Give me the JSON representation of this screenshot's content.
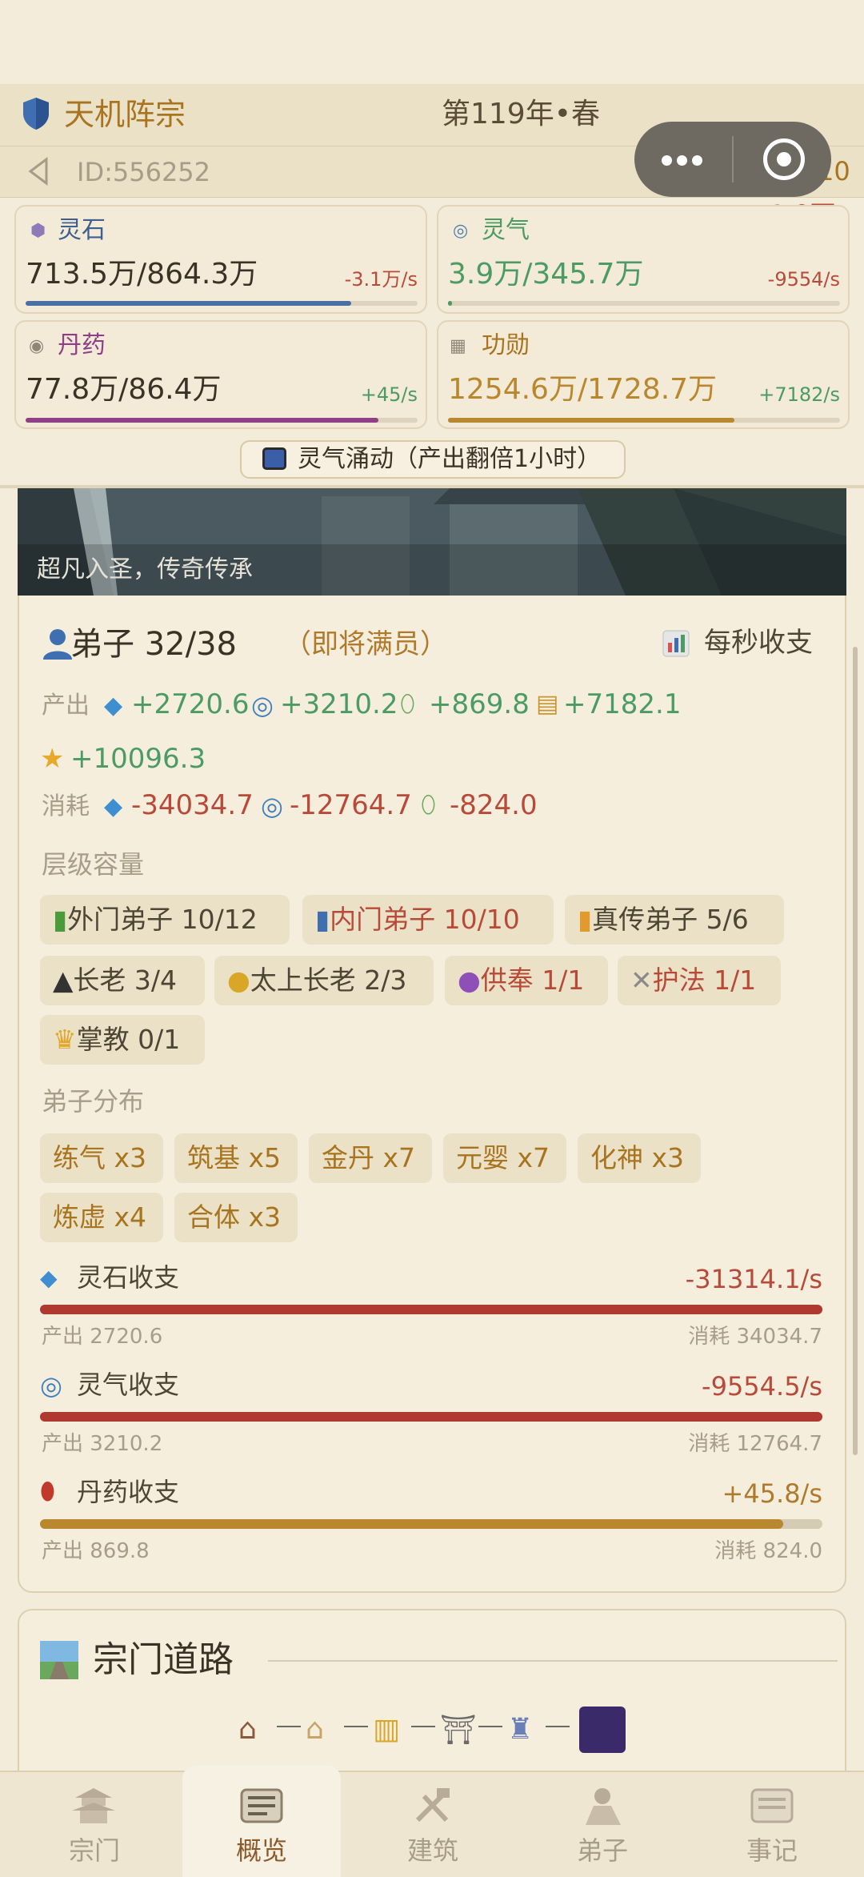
{
  "header": {
    "sect_name": "天机阵宗",
    "year": "第119年•春",
    "user_id": "ID:556252",
    "fame": "10",
    "fame_change": "-1.0万"
  },
  "resources": [
    {
      "name": "灵石",
      "value": "713.5万/864.3万",
      "rate": "-3.1万/s",
      "fill": 0.83,
      "color": "#4a6fa5",
      "icon": "spirit-stone-icon"
    },
    {
      "name": "灵气",
      "value": "3.9万/345.7万",
      "rate": "-9554/s",
      "fill": 0.01,
      "color": "#4b9b62",
      "icon": "qi-swirl-icon"
    },
    {
      "name": "丹药",
      "value": "77.8万/86.4万",
      "rate": "+45/s",
      "fill": 0.9,
      "color": "#8e3f86",
      "icon": "pill-icon"
    },
    {
      "name": "功勋",
      "value": "1254.6万/1728.7万",
      "rate": "+7182/s",
      "fill": 0.73,
      "color": "#b8872e",
      "icon": "merit-icon"
    }
  ],
  "boost": {
    "label": "灵气涌动（产出翻倍1小时）"
  },
  "banner": {
    "caption": "超凡入圣，传奇传承"
  },
  "disciples": {
    "title": "弟子 32/38",
    "note": "（即将满员）",
    "per_second": "每秒收支",
    "output_label": "产出",
    "consume_label": "消耗",
    "output": [
      "+2720.6",
      "+3210.2",
      "+869.8",
      "+7182.1",
      "+10096.3"
    ],
    "consume": [
      "-34034.7",
      "-12764.7",
      "-824.0"
    ],
    "tiers_label": "层级容量",
    "tiers": [
      {
        "label": "外门弟子 10/12",
        "icon": "green-book-icon"
      },
      {
        "label": "内门弟子 10/10",
        "icon": "blue-book-icon"
      },
      {
        "label": "真传弟子 5/6",
        "icon": "orange-book-icon"
      },
      {
        "label": "长老 3/4",
        "icon": "grad-cap-icon"
      },
      {
        "label": "太上长老 2/3",
        "icon": "medal-icon"
      },
      {
        "label": "供奉 1/1",
        "icon": "crystal-ball-icon"
      },
      {
        "label": "护法 1/1",
        "icon": "crossed-swords-icon"
      },
      {
        "label": "掌教 0/1",
        "icon": "crown-icon"
      }
    ],
    "dist_label": "弟子分布",
    "dist": [
      "练气 x3",
      "筑基 x5",
      "金丹 x7",
      "元婴 x7",
      "化神 x3",
      "炼虚 x4",
      "合体 x3"
    ]
  },
  "flows": [
    {
      "title": "灵石收支",
      "value": "-31314.1/s",
      "out": "产出 2720.6",
      "cons": "消耗 34034.7",
      "fill": 1.0,
      "color": "#b0392f",
      "icon": "diamond-icon"
    },
    {
      "title": "灵气收支",
      "value": "-9554.5/s",
      "out": "产出 3210.2",
      "cons": "消耗 12764.7",
      "fill": 1.0,
      "color": "#b0392f",
      "icon": "qi-swirl-icon"
    },
    {
      "title": "丹药收支",
      "value": "+45.8/s",
      "out": "产出 869.8",
      "cons": "消耗 824.0",
      "fill": 0.95,
      "color": "#b8872e",
      "icon": "pill-icon"
    }
  ],
  "road": {
    "title": "宗门道路"
  },
  "tabs": [
    {
      "label": "宗门",
      "icon": "pagoda-icon"
    },
    {
      "label": "概览",
      "icon": "scroll-icon"
    },
    {
      "label": "建筑",
      "icon": "tools-icon"
    },
    {
      "label": "弟子",
      "icon": "disciple-icon"
    },
    {
      "label": "事记",
      "icon": "record-icon"
    }
  ],
  "colors": {
    "accent": "#a8741f",
    "positive": "#4b9b62",
    "negative": "#b84a3a",
    "background": "#f3ecdb"
  }
}
